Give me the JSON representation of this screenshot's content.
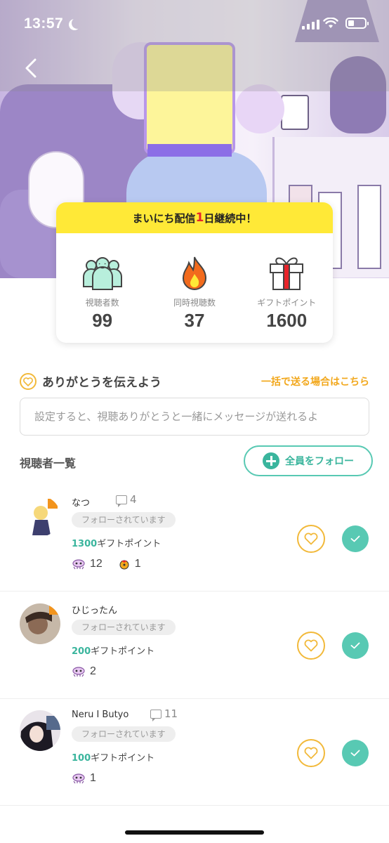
{
  "status_bar": {
    "time": "13:57"
  },
  "streak": {
    "prefix": "まいにち配信",
    "days": "1",
    "unit": "日",
    "suffix": "継続中！"
  },
  "stats": [
    {
      "icon": "viewers-icon",
      "label": "視聴者数",
      "value": "99"
    },
    {
      "icon": "flame-icon",
      "label": "同時視聴数",
      "value": "37"
    },
    {
      "icon": "gift-icon",
      "label": "ギフトポイント",
      "value": "1600"
    }
  ],
  "thanks": {
    "title": "ありがとうを伝えよう",
    "bulk_link": "一括で送る場合はこちら",
    "input_placeholder": "設定すると、視聴ありがとうと一緒にメッセージが送れるよ"
  },
  "viewers_section": {
    "title": "視聴者一覧",
    "follow_all_label": "全員をフォロー"
  },
  "viewers": [
    {
      "name": "なつ",
      "comments": "4",
      "follow_status": "フォローされています",
      "gift_points": "1300",
      "gift_unit": "ギフトポイント",
      "badge1_count": "12",
      "badge2_count": "1"
    },
    {
      "name": "ひじったん",
      "follow_status": "フォローされています",
      "gift_points": "200",
      "gift_unit": "ギフトポイント",
      "badge1_count": "2"
    },
    {
      "name": "Neru I Butyo",
      "comments": "11",
      "follow_status": "フォローされています",
      "gift_points": "100",
      "gift_unit": "ギフトポイント",
      "badge1_count": "1"
    }
  ],
  "colors": {
    "accent_green": "#3ab59d",
    "accent_yellow": "#ffe937",
    "heart_orange": "#f2b93a",
    "streak_red": "#e8242a"
  }
}
